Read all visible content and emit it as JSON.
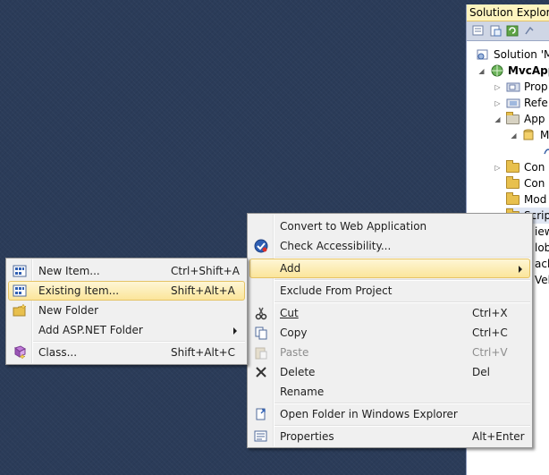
{
  "solution_explorer": {
    "title": "Solution Explorer",
    "tree": [
      {
        "label": "Solution 'M",
        "bold": false,
        "icon": "solution-icon",
        "arrow": ""
      },
      {
        "label": "MvcApp",
        "bold": true,
        "icon": "web-project-icon",
        "arrow": "◢"
      },
      {
        "label": "Prop",
        "bold": false,
        "icon": "properties-folder-icon",
        "arrow": "▷"
      },
      {
        "label": "Refe",
        "bold": false,
        "icon": "references-icon",
        "arrow": "▷"
      },
      {
        "label": "App",
        "bold": false,
        "icon": "folder-icon",
        "arrow": "◢"
      },
      {
        "label": "M",
        "bold": false,
        "icon": "database-icon",
        "arrow": "◢"
      },
      {
        "label": "",
        "bold": false,
        "icon": "log-file-icon",
        "arrow": ""
      },
      {
        "label": "Con",
        "bold": false,
        "icon": "folder-icon",
        "arrow": "▷"
      },
      {
        "label": "Con",
        "bold": false,
        "icon": "folder-icon",
        "arrow": ""
      },
      {
        "label": "Mod",
        "bold": false,
        "icon": "folder-icon",
        "arrow": ""
      },
      {
        "label": "Scrip",
        "bold": false,
        "icon": "folder-icon",
        "arrow": ""
      },
      {
        "label": "iew",
        "bold": false,
        "icon": "",
        "arrow": ""
      },
      {
        "label": "lob",
        "bold": false,
        "icon": "",
        "arrow": ""
      },
      {
        "label": "ack",
        "bold": false,
        "icon": "",
        "arrow": ""
      },
      {
        "label": "Vel",
        "bold": false,
        "icon": "",
        "arrow": ""
      }
    ]
  },
  "main_menu": {
    "items": [
      {
        "type": "item",
        "label": "Convert to Web Application",
        "shortcut": "",
        "icon": "",
        "disabled": false,
        "highlighted": false,
        "submenu": false
      },
      {
        "type": "item",
        "label": "Check Accessibility...",
        "shortcut": "",
        "icon": "accessibility-icon",
        "disabled": false,
        "highlighted": false,
        "submenu": false
      },
      {
        "type": "sep"
      },
      {
        "type": "item",
        "label": "Add",
        "shortcut": "",
        "icon": "",
        "disabled": false,
        "highlighted": true,
        "submenu": true
      },
      {
        "type": "sep"
      },
      {
        "type": "item",
        "label": "Exclude From Project",
        "shortcut": "",
        "icon": "",
        "disabled": false,
        "highlighted": false,
        "submenu": false
      },
      {
        "type": "sep"
      },
      {
        "type": "item",
        "label": "Cut",
        "shortcut": "Ctrl+X",
        "icon": "scissors-icon",
        "disabled": false,
        "highlighted": false,
        "submenu": false
      },
      {
        "type": "item",
        "label": "Copy",
        "shortcut": "Ctrl+C",
        "icon": "copy-icon",
        "disabled": false,
        "highlighted": false,
        "submenu": false
      },
      {
        "type": "item",
        "label": "Paste",
        "shortcut": "Ctrl+V",
        "icon": "paste-icon",
        "disabled": true,
        "highlighted": false,
        "submenu": false
      },
      {
        "type": "item",
        "label": "Delete",
        "shortcut": "Del",
        "icon": "delete-x-icon",
        "disabled": false,
        "highlighted": false,
        "submenu": false
      },
      {
        "type": "item",
        "label": "Rename",
        "shortcut": "",
        "icon": "",
        "disabled": false,
        "highlighted": false,
        "submenu": false
      },
      {
        "type": "sep"
      },
      {
        "type": "item",
        "label": "Open Folder in Windows Explorer",
        "shortcut": "",
        "icon": "open-folder-icon",
        "disabled": false,
        "highlighted": false,
        "submenu": false
      },
      {
        "type": "sep"
      },
      {
        "type": "item",
        "label": "Properties",
        "shortcut": "Alt+Enter",
        "icon": "properties-icon",
        "disabled": false,
        "highlighted": false,
        "submenu": false
      }
    ]
  },
  "add_submenu": {
    "items": [
      {
        "type": "item",
        "label": "New Item...",
        "shortcut": "Ctrl+Shift+A",
        "icon": "new-item-icon",
        "highlighted": false,
        "submenu": false
      },
      {
        "type": "item",
        "label": "Existing Item...",
        "shortcut": "Shift+Alt+A",
        "icon": "existing-item-icon",
        "highlighted": true,
        "submenu": false
      },
      {
        "type": "item",
        "label": "New Folder",
        "shortcut": "",
        "icon": "new-folder-icon",
        "highlighted": false,
        "submenu": false
      },
      {
        "type": "item",
        "label": "Add ASP.NET Folder",
        "shortcut": "",
        "icon": "",
        "highlighted": false,
        "submenu": true
      },
      {
        "type": "sep"
      },
      {
        "type": "item",
        "label": "Class...",
        "shortcut": "Shift+Alt+C",
        "icon": "class-icon",
        "highlighted": false,
        "submenu": false
      }
    ]
  },
  "colors": {
    "desktop": "#2b3c59",
    "menu_bg": "#f0f0f0",
    "highlight_border": "#e5c365",
    "disabled_text": "#8d8d8d"
  }
}
